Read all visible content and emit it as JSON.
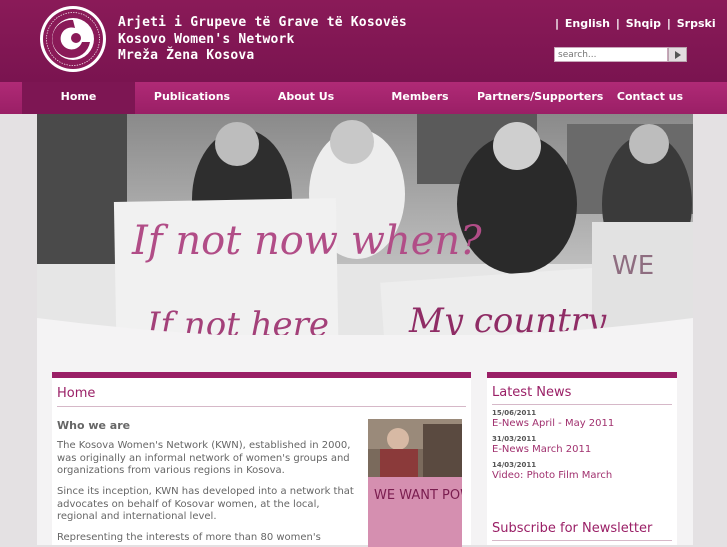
{
  "site": {
    "title_lines": [
      "Arjeti i Grupeve të Grave të Kosovës",
      "Kosovo Women's Network",
      "Mreža Žena Kosova"
    ],
    "logo_ring_text": "RRJETI I GRUPEVE TË GRAVE TË KOSOVËS · KOSOVO WOMEN'S NETWORK"
  },
  "languages": {
    "sep": "|",
    "items": [
      "English",
      "Shqip",
      "Srpski"
    ]
  },
  "search": {
    "placeholder": "search...",
    "button_icon": "play-arrow-icon"
  },
  "nav": {
    "items": [
      "Home",
      "Publications",
      "About Us",
      "Members",
      "Partners/Supporters",
      "Contact us"
    ],
    "active_index": 0
  },
  "hero": {
    "sign_left": "If not now when?",
    "sign_left_2": "If not here",
    "sign_right": "My country",
    "sign_far": "WE"
  },
  "main": {
    "heading": "Home",
    "subheading": "Who we are",
    "paragraphs": [
      "The Kosova Women's Network (KWN), established in 2000, was originally an informal network of women's groups and organizations from various regions in Kosova.",
      "Since its inception, KWN has developed into a network that advocates on behalf of Kosovar women, at the local, regional and international level.",
      "Representing the interests of more than 80 women's"
    ],
    "photo_sign": "WE WANT POWER"
  },
  "sidebar": {
    "heading": "Latest News",
    "news": [
      {
        "date": "15/06/2011",
        "title": "E-News April - May 2011"
      },
      {
        "date": "31/03/2011",
        "title": "E-News March 2011"
      },
      {
        "date": "14/03/2011",
        "title": "Video: Photo Film March"
      }
    ],
    "newsletter_heading": "Subscribe for Newsletter"
  },
  "colors": {
    "brand": "#8a1a58",
    "nav": "#9a1f66",
    "accent_text": "#a0306e"
  }
}
